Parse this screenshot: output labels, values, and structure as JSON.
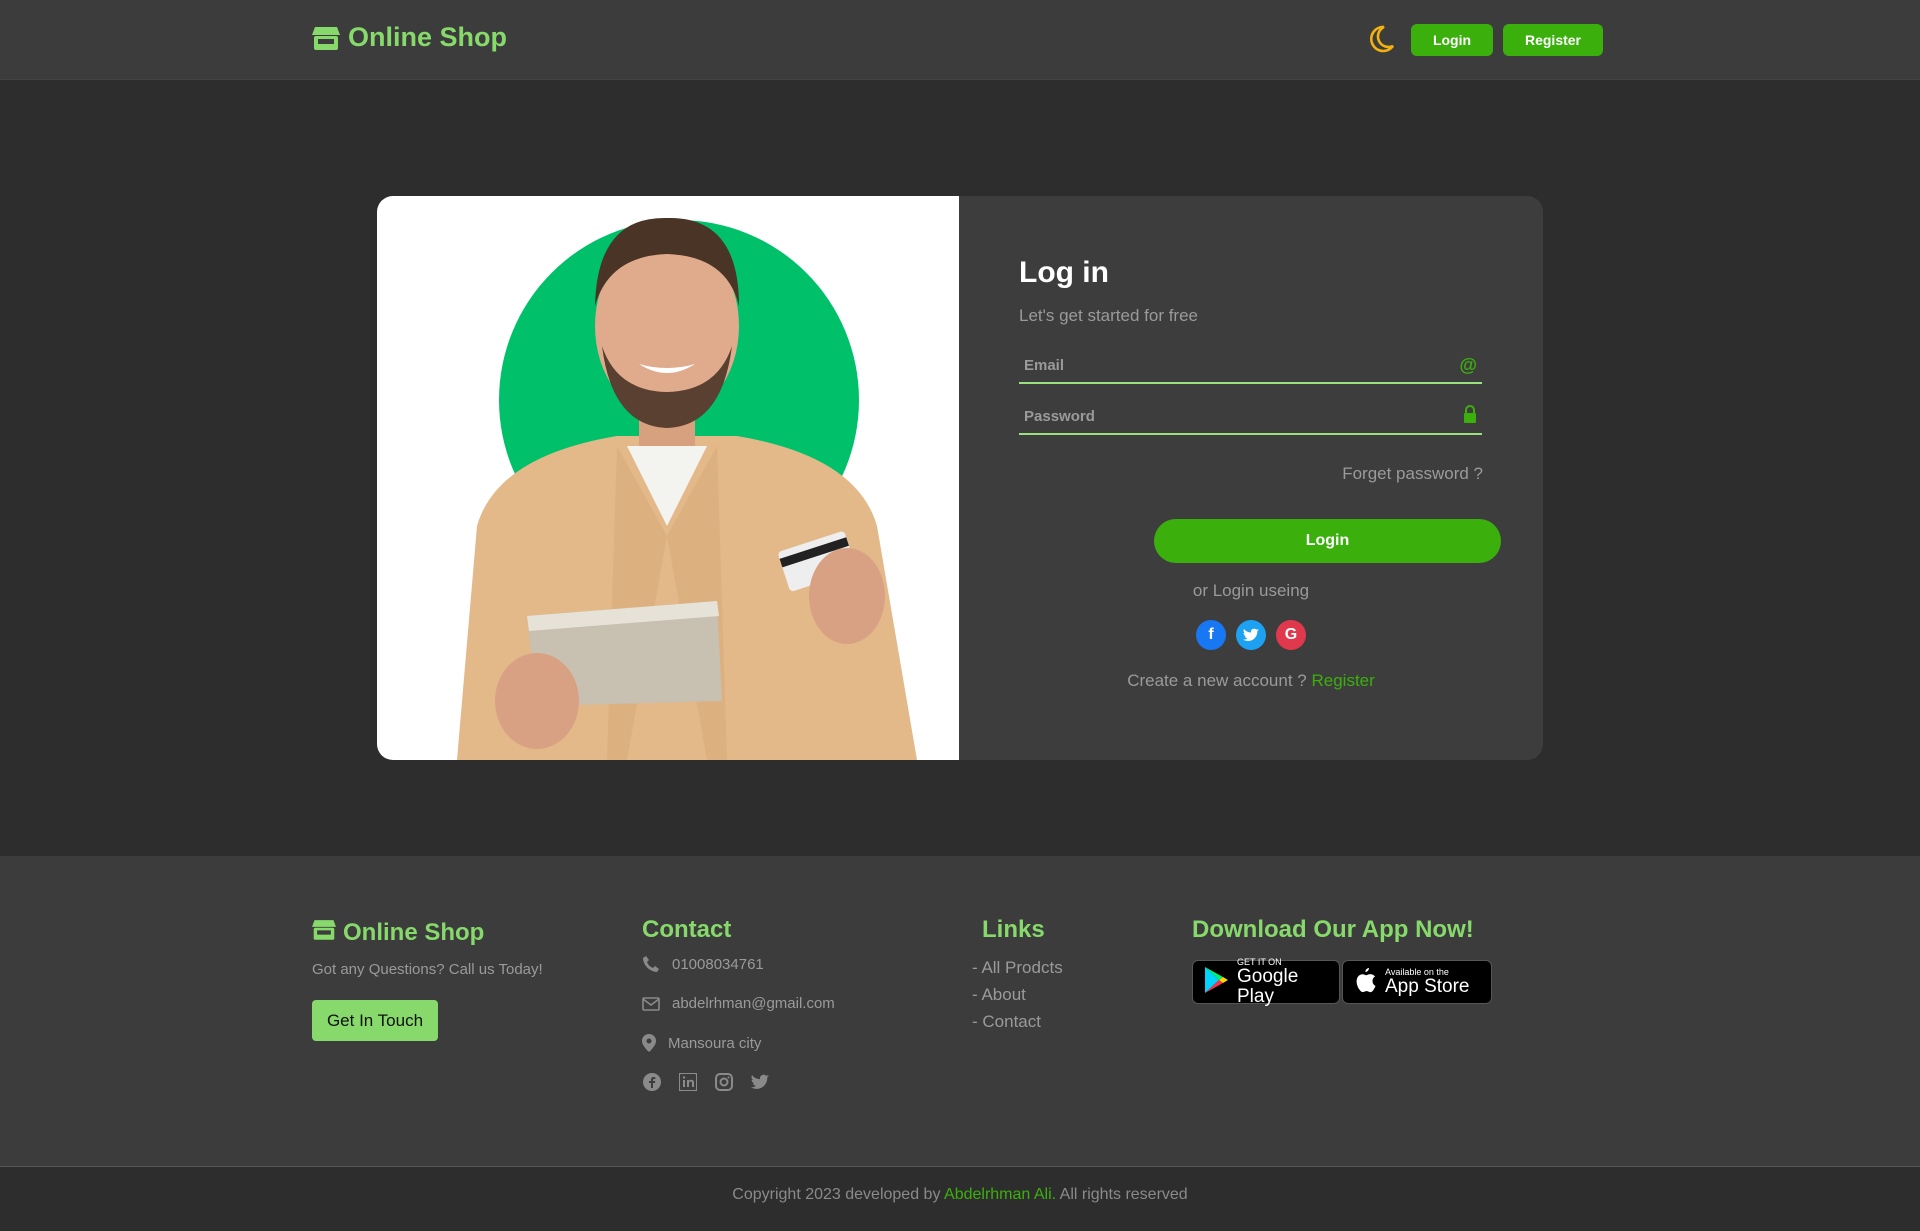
{
  "header": {
    "brand": "Online Shop",
    "login_label": "Login",
    "register_label": "Register"
  },
  "login": {
    "title": "Log in",
    "subtitle": "Let's get started for free",
    "email_placeholder": "Email",
    "password_placeholder": "Password",
    "forget_label": "Forget password ?",
    "submit_label": "Login",
    "or_label": "or Login useing",
    "create_text": "Create a new account ?",
    "register_link": "Register"
  },
  "footer": {
    "brand": "Online Shop",
    "tagline": "Got any Questions? Call us Today!",
    "touch_label": "Get In Touch",
    "contact_title": "Contact",
    "phone": "01008034761",
    "email": "abdelrhman@gmail.com",
    "location": "Mansoura city",
    "links_title": "Links",
    "links": [
      "- All Prodcts",
      "- About",
      "- Contact"
    ],
    "app_title": "Download Our App Now!",
    "google_small": "GET IT ON",
    "google_big": "Google Play",
    "apple_small": "Available on the",
    "apple_big": "App Store",
    "copyright_prefix": "Copyright 2023 developed by",
    "copyright_author": "Abdelrhman Ali.",
    "copyright_suffix": "All rights reserved"
  },
  "colors": {
    "accent": "#3bb00d",
    "brand_green": "#86d96a",
    "background": "#2d2d2d",
    "panel": "#3d3d3d"
  },
  "icons": {
    "brand": "shop-icon",
    "theme": "moon-icon",
    "email": "at-icon",
    "password": "lock-icon"
  }
}
